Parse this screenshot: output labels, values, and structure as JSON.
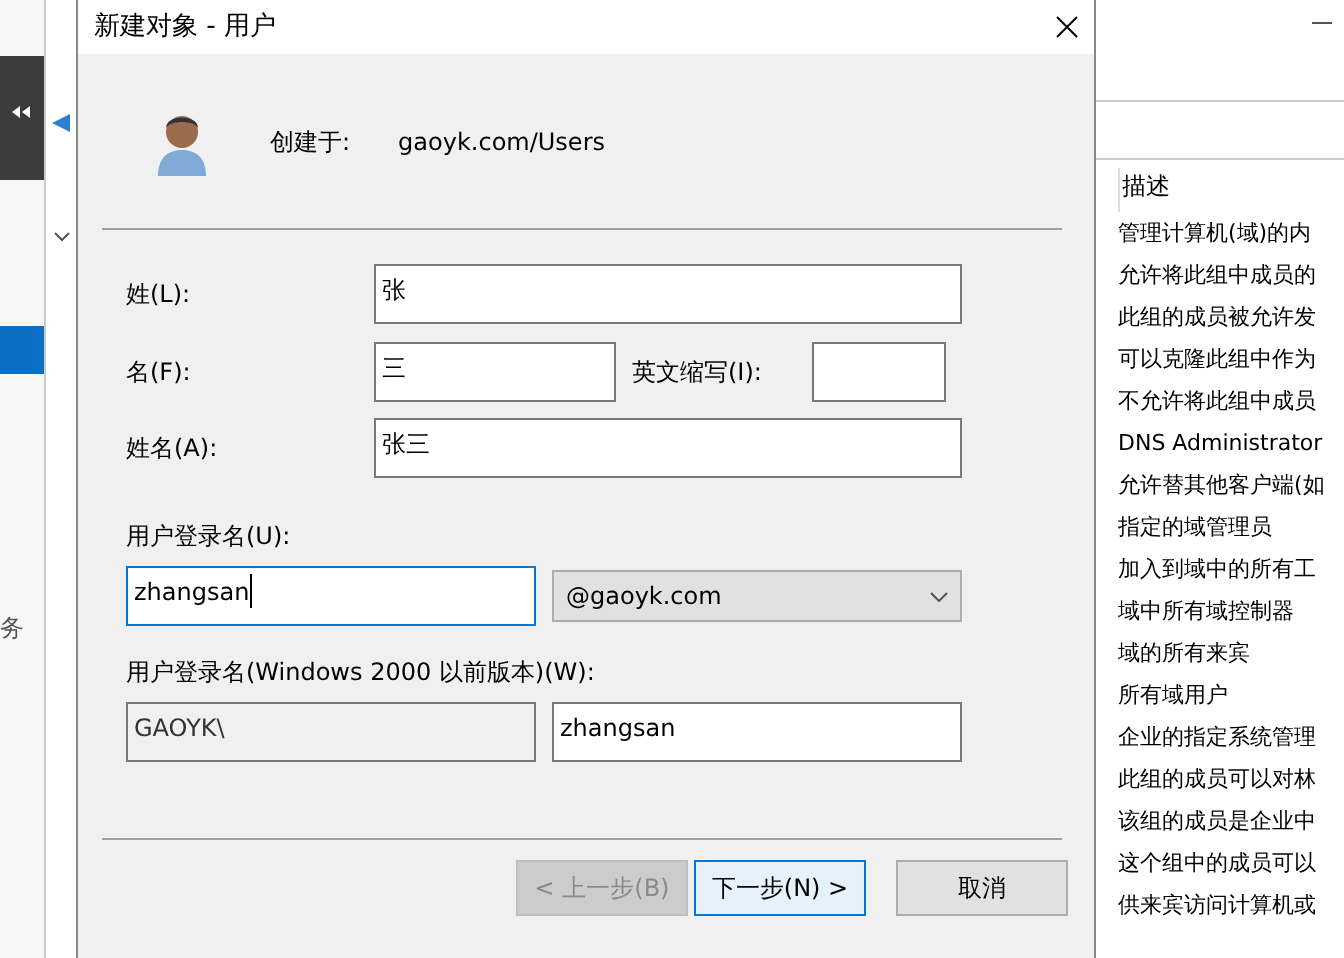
{
  "background_window": {
    "left_pane": {
      "text": "务"
    },
    "right_pane": {
      "header": "描述",
      "rows": [
        "管理计算机(域)的内",
        "允许将此组中成员的",
        "此组的成员被允许发",
        "可以克隆此组中作为",
        "不允许将此组中成员",
        "DNS Administrator",
        "允许替其他客户端(如",
        "指定的域管理员",
        "加入到域中的所有工",
        "域中所有域控制器",
        "域的所有来宾",
        "所有域用户",
        "企业的指定系统管理",
        "此组的成员可以对林",
        "该组的成员是企业中",
        "这个组中的成员可以",
        "供来宾访问计算机或"
      ]
    }
  },
  "dialog": {
    "title": "新建对象 - 用户",
    "created_in": {
      "label": "创建于:",
      "value": "gaoyk.com/Users"
    },
    "surname": {
      "label": "姓(L):",
      "value": "张"
    },
    "given_name": {
      "label": "名(F):",
      "value": "三"
    },
    "initials": {
      "label": "英文缩写(I):"
    },
    "full_name": {
      "label": "姓名(A):",
      "value": "张三"
    },
    "logon_name": {
      "label": "用户登录名(U):",
      "value": "zhangsan",
      "focused": true,
      "domain": "@gaoyk.com"
    },
    "legacy_logon": {
      "label": "用户登录名(Windows 2000 以前版本)(W):",
      "prefix": "GAOYK\\",
      "value": "zhangsan"
    },
    "buttons": [
      {
        "label": "< 上一步(B)",
        "disabled": true,
        "default": false
      },
      {
        "label": "下一步(N) >",
        "disabled": false,
        "default": true
      },
      {
        "label": "取消",
        "disabled": false,
        "default": false
      }
    ]
  }
}
